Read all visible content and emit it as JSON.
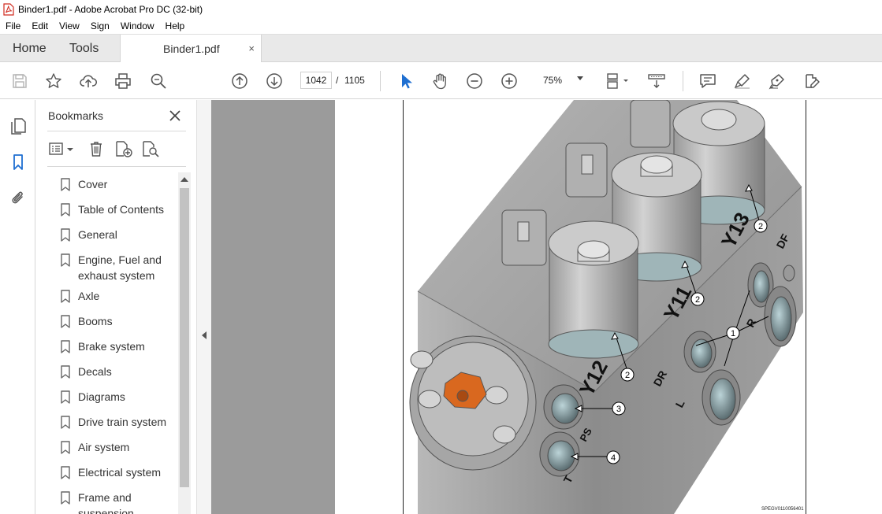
{
  "window": {
    "title": "Binder1.pdf - Adobe Acrobat Pro DC (32-bit)"
  },
  "menu": [
    "File",
    "Edit",
    "View",
    "Sign",
    "Window",
    "Help"
  ],
  "tabs": {
    "home": "Home",
    "tools": "Tools",
    "document": "Binder1.pdf",
    "close": "×"
  },
  "toolbar": {
    "page_current": "1042",
    "page_separator": "/",
    "page_total": "1105",
    "zoom": "75%"
  },
  "bookmarks": {
    "title": "Bookmarks",
    "items": [
      "Cover",
      "Table of Contents",
      "General",
      "Engine, Fuel and exhaust system",
      "Axle",
      "Booms",
      "Brake system",
      "Decals",
      "Diagrams",
      "Drive train system",
      "Air system",
      "Electrical system",
      "Frame and suspension"
    ]
  },
  "document": {
    "labels": {
      "y12": "Y12",
      "y11": "Y11",
      "y13": "Y13",
      "df": "DF",
      "dr": "DR",
      "r": "R",
      "l": "L",
      "t": "T",
      "ps": "PS"
    },
    "callouts": [
      "1",
      "2",
      "3",
      "4"
    ],
    "image_id": "SPEGV0110056401"
  },
  "colors": {
    "accent": "#1f6fd1",
    "valve_body": "#8e8e8e",
    "plug": "#d9681f"
  }
}
